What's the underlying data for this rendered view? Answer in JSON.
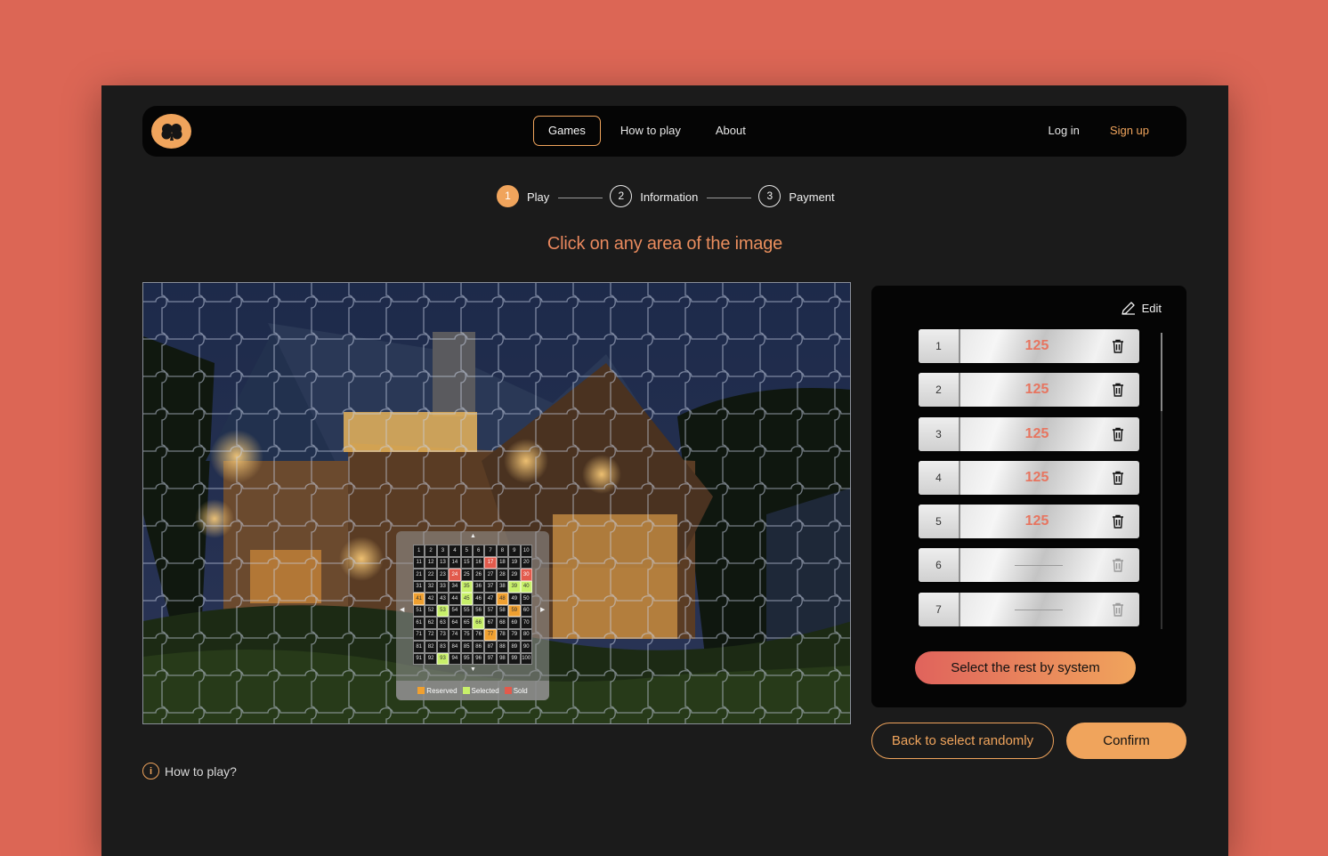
{
  "nav": {
    "links": [
      "Games",
      "How to play",
      "About"
    ],
    "active": "Games",
    "login": "Log in",
    "signup": "Sign up"
  },
  "stepper": {
    "steps": [
      {
        "number": "1",
        "label": "Play"
      },
      {
        "number": "2",
        "label": "Information"
      },
      {
        "number": "3",
        "label": "Payment"
      }
    ],
    "current": 1
  },
  "headline": "Click on any area of the image",
  "mini_map": {
    "cells": [
      "1",
      "2",
      "3",
      "4",
      "5",
      "6",
      "7",
      "8",
      "9",
      "10",
      "11",
      "12",
      "13",
      "14",
      "15",
      "16",
      "17",
      "18",
      "19",
      "20",
      "21",
      "22",
      "23",
      "24",
      "25",
      "26",
      "27",
      "28",
      "29",
      "30",
      "31",
      "32",
      "33",
      "34",
      "35",
      "36",
      "37",
      "38",
      "39",
      "40",
      "41",
      "42",
      "43",
      "44",
      "45",
      "46",
      "47",
      "48",
      "49",
      "50",
      "51",
      "52",
      "53",
      "54",
      "55",
      "56",
      "57",
      "58",
      "59",
      "60",
      "61",
      "62",
      "63",
      "64",
      "65",
      "66",
      "67",
      "68",
      "69",
      "70",
      "71",
      "72",
      "73",
      "74",
      "75",
      "76",
      "77",
      "78",
      "79",
      "80",
      "81",
      "82",
      "83",
      "84",
      "85",
      "86",
      "87",
      "88",
      "89",
      "90",
      "91",
      "92",
      "93",
      "94",
      "95",
      "96",
      "97",
      "98",
      "99",
      "100"
    ],
    "reserved": [
      41,
      48,
      59,
      77
    ],
    "selected": [
      35,
      39,
      40,
      45,
      53,
      66,
      93
    ],
    "sold": [
      17,
      24,
      30
    ],
    "legend": {
      "reserved": "Reserved",
      "selected": "Selected",
      "sold": "Sold"
    },
    "colors": {
      "reserved": "#f0a030",
      "selected": "#c8f06a",
      "sold": "#e25a4c"
    }
  },
  "howto": "How to play?",
  "panel": {
    "edit_label": "Edit",
    "rows": [
      {
        "num": "1",
        "value": "125"
      },
      {
        "num": "2",
        "value": "125"
      },
      {
        "num": "3",
        "value": "125"
      },
      {
        "num": "4",
        "value": "125"
      },
      {
        "num": "5",
        "value": "125"
      },
      {
        "num": "6",
        "value": ""
      },
      {
        "num": "7",
        "value": ""
      }
    ],
    "system_button": "Select the rest by system"
  },
  "actions": {
    "back": "Back to select randomly",
    "confirm": "Confirm"
  },
  "colors": {
    "accent": "#f0a45c",
    "accent_red": "#e77560",
    "background": "#1b1b1b",
    "outer": "#dc6655"
  }
}
